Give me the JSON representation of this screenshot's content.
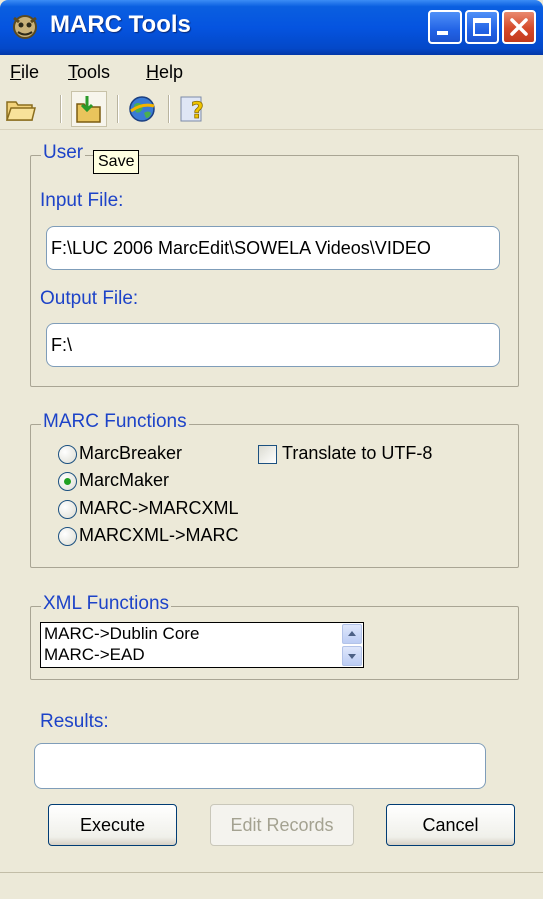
{
  "window": {
    "title": "MARC Tools",
    "icons": {
      "app": "marc-tools-app-icon",
      "minimize": "minimize-icon",
      "maximize": "maximize-icon",
      "close": "close-icon"
    }
  },
  "menu": {
    "file": "File",
    "tools": "Tools",
    "help": "Help"
  },
  "toolbar": {
    "icons": [
      "open-folder-icon",
      "save-icon",
      "web-globe-icon",
      "help-icon"
    ],
    "tooltip": "Save"
  },
  "user_group": {
    "legend": "User",
    "input_label": "Input File:",
    "input_value": "F:\\LUC 2006 MarcEdit\\SOWELA Videos\\VIDEO",
    "output_label": "Output File:",
    "output_value": "F:\\"
  },
  "marc_group": {
    "legend": "MARC Functions",
    "options": [
      {
        "label": "MarcBreaker",
        "checked": false
      },
      {
        "label": "MarcMaker",
        "checked": true
      },
      {
        "label": "MARC->MARCXML",
        "checked": false
      },
      {
        "label": "MARCXML->MARC",
        "checked": false
      }
    ],
    "translate_label": "Translate to UTF-8",
    "translate_checked": false
  },
  "xml_group": {
    "legend": "XML Functions",
    "items": [
      "MARC->Dublin Core",
      "MARC->EAD"
    ]
  },
  "results": {
    "label": "Results:",
    "value": ""
  },
  "buttons": {
    "execute": "Execute",
    "edit": "Edit Records",
    "cancel": "Cancel"
  },
  "colors": {
    "titlebar": "#0554e0",
    "label_blue": "#1d43c8",
    "window_bg": "#ece9d8"
  }
}
